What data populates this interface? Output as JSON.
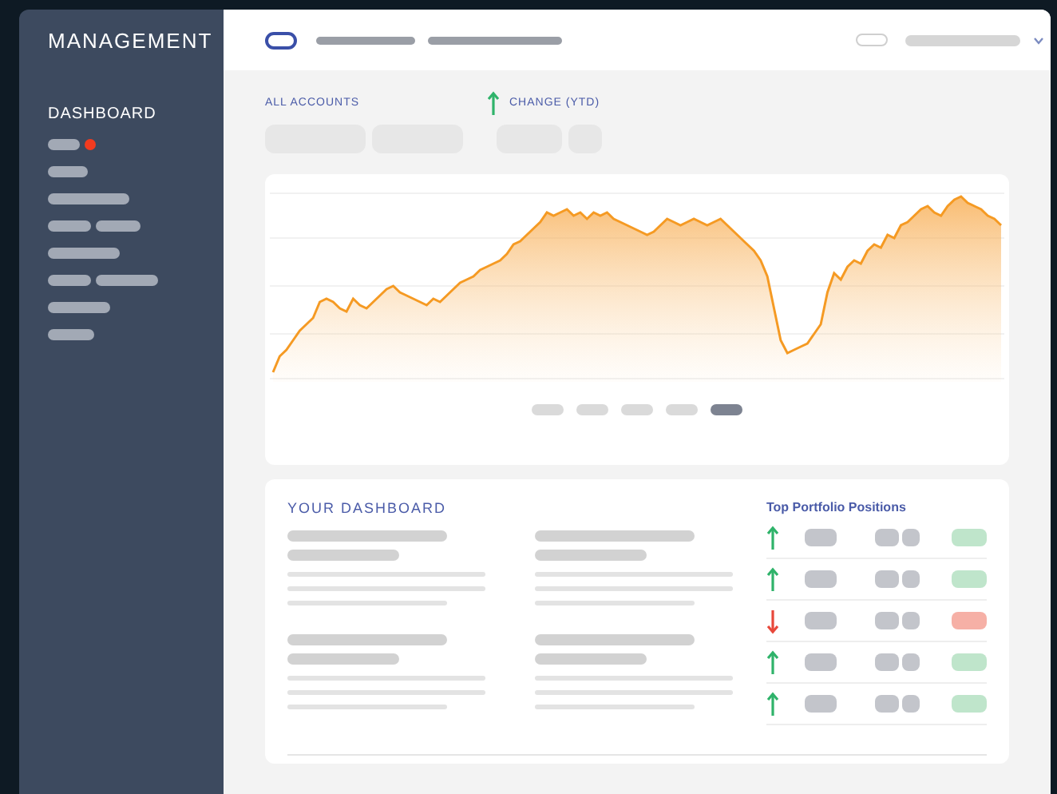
{
  "sidebar": {
    "title": "MANAGEMENT",
    "nav_label": "DASHBOARD"
  },
  "summary": {
    "accounts_label": "ALL ACCOUNTS",
    "change_label": "CHANGE (YTD)",
    "change_rising": true
  },
  "chart_pager": [
    {
      "selected": false
    },
    {
      "selected": false
    },
    {
      "selected": false
    },
    {
      "selected": false
    },
    {
      "selected": true
    }
  ],
  "dashboard": {
    "title": "YOUR DASHBOARD"
  },
  "positions": {
    "title": "Top Portfolio Positions",
    "rows": [
      {
        "rising": true
      },
      {
        "rising": true
      },
      {
        "rising": false
      },
      {
        "rising": true
      },
      {
        "rising": true
      }
    ]
  }
}
